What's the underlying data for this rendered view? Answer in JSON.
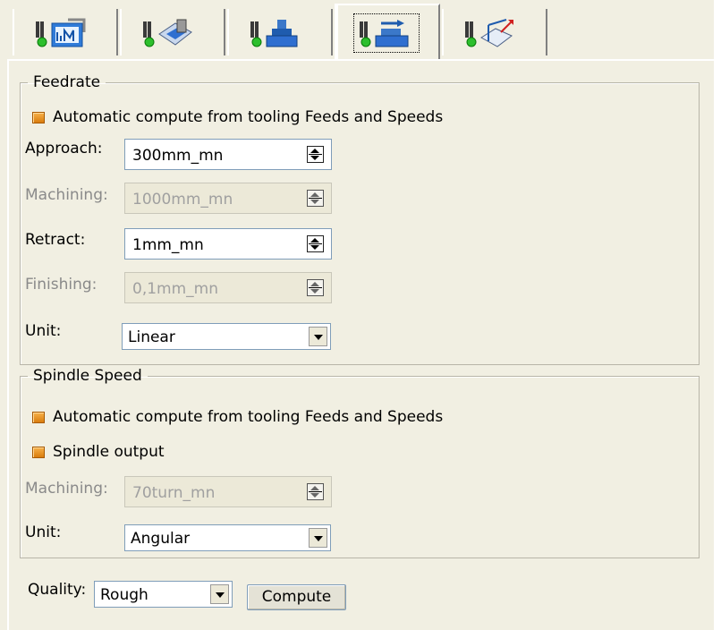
{
  "tabs": [
    {
      "id": "geometry",
      "icon": "geometry-tab-icon"
    },
    {
      "id": "strategy",
      "icon": "strategy-tab-icon"
    },
    {
      "id": "tool",
      "icon": "tool-tab-icon"
    },
    {
      "id": "feeds-speeds",
      "icon": "feeds-speeds-tab-icon",
      "active": true
    },
    {
      "id": "macros",
      "icon": "macros-tab-icon"
    }
  ],
  "feedrate": {
    "legend": "Feedrate",
    "auto_label": "Automatic compute from tooling Feeds and Speeds",
    "approach_label": "Approach:",
    "approach_value": "300mm_mn",
    "machining_label": "Machining:",
    "machining_value": "1000mm_mn",
    "retract_label": "Retract:",
    "retract_value": "1mm_mn",
    "finishing_label": "Finishing:",
    "finishing_value": "0,1mm_mn",
    "unit_label": "Unit:",
    "unit_value": "Linear"
  },
  "spindle": {
    "legend": "Spindle Speed",
    "auto_label": "Automatic compute from tooling Feeds and Speeds",
    "output_label": "Spindle output",
    "machining_label": "Machining:",
    "machining_value": "70turn_mn",
    "unit_label": "Unit:",
    "unit_value": "Angular"
  },
  "quality": {
    "label": "Quality:",
    "value": "Rough",
    "compute_label": "Compute"
  },
  "colors": {
    "background": "#f1efe2",
    "checkbox": "#e8951f"
  }
}
